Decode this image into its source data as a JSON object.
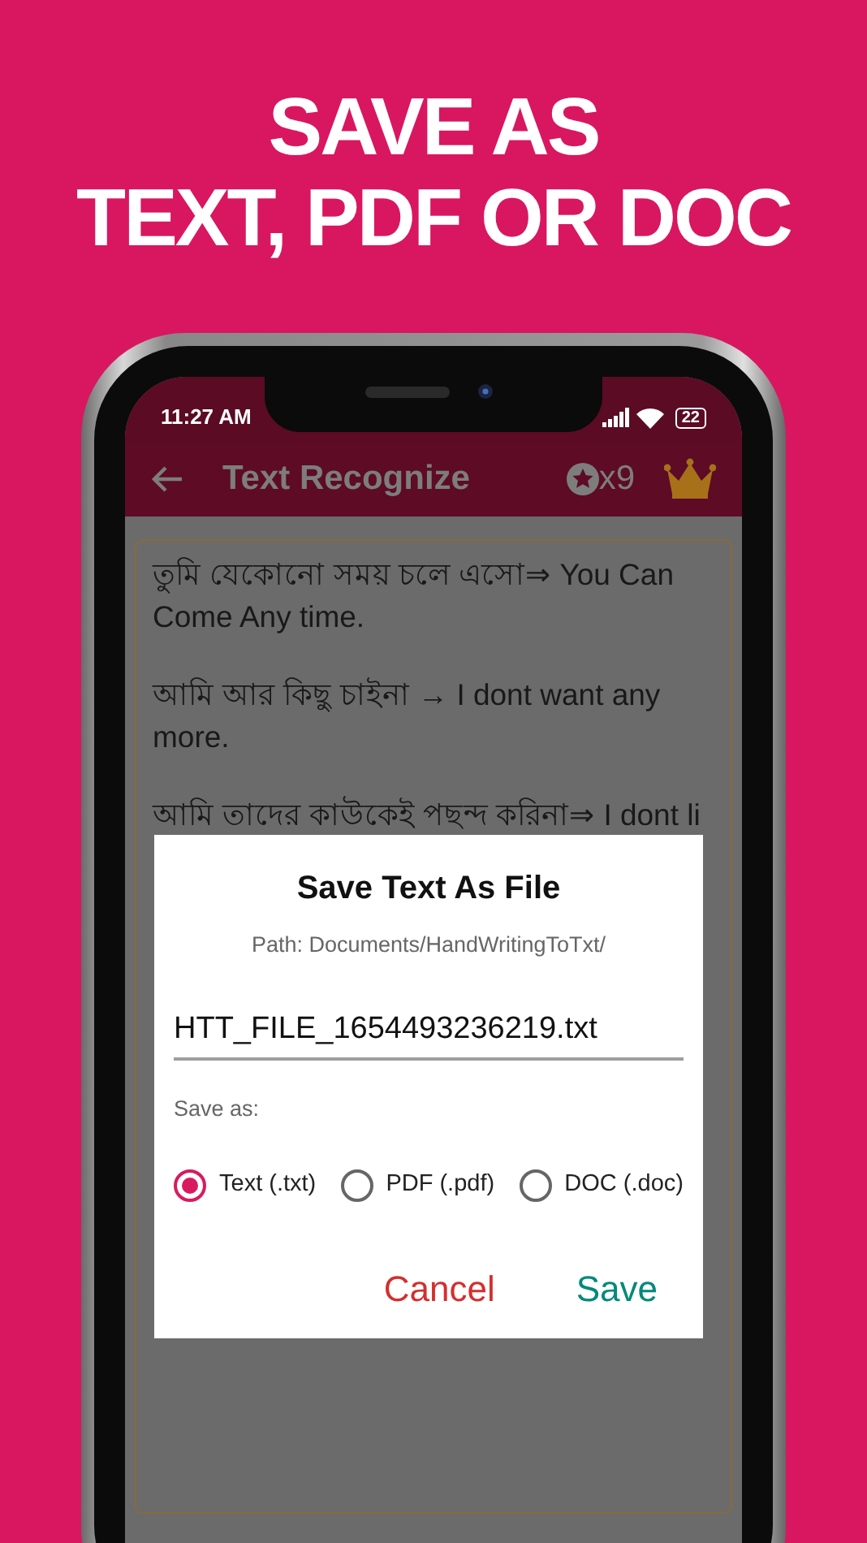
{
  "headline": [
    "SAVE AS",
    "TEXT, PDF OR DOC"
  ],
  "status_bar": {
    "time": "11:27 AM",
    "battery": "22"
  },
  "app_bar": {
    "title": "Text Recognize",
    "coins": "x9"
  },
  "paragraphs": [
    "তুমি যেকোনো সময় চলে এসো⇒ You Can Come Any time.",
    "আমি আর কিছু চাইনা → I dont want any more.",
    "আমি তাদের কাউকেই পছন্দ করিনা⇒ I dont li"
  ],
  "dialog": {
    "title": "Save Text As File",
    "path": "Path: Documents/HandWritingToTxt/",
    "file_name": "HTT_FILE_1654493236219.txt",
    "save_as_label": "Save as:",
    "formats": [
      {
        "label": "Text (.txt)",
        "selected": true
      },
      {
        "label": "PDF (.pdf)",
        "selected": false
      },
      {
        "label": "DOC (.doc)",
        "selected": false
      }
    ],
    "buttons": [
      {
        "label": "Cancel",
        "kind": "cancel"
      },
      {
        "label": "Save",
        "kind": "confirm"
      }
    ]
  }
}
